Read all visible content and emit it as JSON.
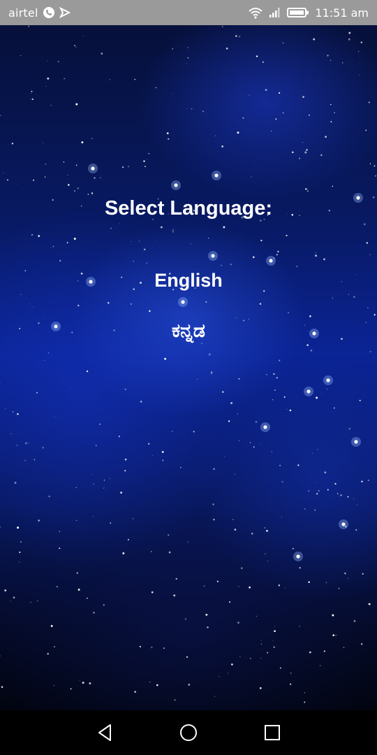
{
  "status_bar": {
    "carrier": "airtel",
    "time": "11:51 am",
    "icons": [
      "whatsapp-call-icon",
      "notification-icon",
      "wifi-icon",
      "signal-icon",
      "battery-icon"
    ]
  },
  "main": {
    "heading": "Select Language:",
    "languages": [
      {
        "label": "English"
      },
      {
        "label": "ಕನ್ನಡ"
      }
    ]
  },
  "nav_bar": {
    "buttons": [
      "back-icon",
      "home-icon",
      "recent-apps-icon"
    ]
  },
  "colors": {
    "status_bar_bg": "#9a9a9a",
    "text": "#ffffff",
    "background_accent": "#0b2496",
    "nav_bar_bg": "#000000"
  }
}
